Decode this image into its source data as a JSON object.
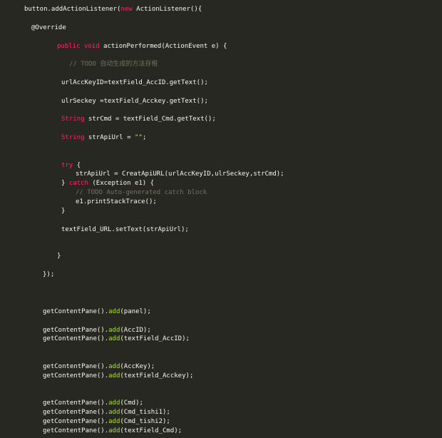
{
  "editor": {
    "background": "#272822",
    "colors": {
      "text": "#f8f8f2",
      "keyword": "#f92672",
      "string": "#e6db74",
      "comment": "#75715e",
      "method": "#a6e22e"
    },
    "lines": [
      {
        "tokens": [
          {
            "t": "button.addActionListener(",
            "c": "plain"
          },
          {
            "t": "new",
            "c": "kw"
          },
          {
            "t": " ActionListener(){",
            "c": "plain"
          }
        ]
      },
      {
        "tokens": [
          {
            "t": "@Override",
            "c": "ann"
          }
        ]
      },
      {
        "tokens": [
          {
            "t": "public",
            "c": "kw"
          },
          {
            "t": " ",
            "c": "plain"
          },
          {
            "t": "void",
            "c": "kw"
          },
          {
            "t": " actionPerformed(ActionEvent e) {",
            "c": "plain"
          }
        ]
      },
      {
        "tokens": [
          {
            "t": "// TODO 自动生成的方法存根",
            "c": "cm"
          }
        ]
      },
      {
        "tokens": [
          {
            "t": "urlAccKeyID=textField_AccID.getText();",
            "c": "plain"
          }
        ]
      },
      {
        "tokens": [
          {
            "t": "ulrSeckey =textField_Acckey.getText();",
            "c": "plain"
          }
        ]
      },
      {
        "tokens": [
          {
            "t": "String",
            "c": "kw"
          },
          {
            "t": " strCmd = textField_Cmd.getText();",
            "c": "plain"
          }
        ]
      },
      {
        "tokens": [
          {
            "t": "String",
            "c": "kw"
          },
          {
            "t": " strApiUrl = ",
            "c": "plain"
          },
          {
            "t": "\"\"",
            "c": "str"
          },
          {
            "t": ";",
            "c": "plain"
          }
        ]
      },
      {
        "tokens": [
          {
            "t": "try",
            "c": "kw"
          },
          {
            "t": " {",
            "c": "plain"
          }
        ]
      },
      {
        "tokens": [
          {
            "t": "strApiUrl = CreatApiURL(urlAccKeyID,ulrSeckey,strCmd);",
            "c": "plain"
          }
        ]
      },
      {
        "tokens": [
          {
            "t": "} ",
            "c": "plain"
          },
          {
            "t": "catch",
            "c": "kw"
          },
          {
            "t": " (Exception e1) {",
            "c": "plain"
          }
        ]
      },
      {
        "tokens": [
          {
            "t": "// TODO Auto-generated catch block",
            "c": "cm"
          }
        ]
      },
      {
        "tokens": [
          {
            "t": "e1.printStackTrace();",
            "c": "plain"
          }
        ]
      },
      {
        "tokens": [
          {
            "t": "}",
            "c": "plain"
          }
        ]
      },
      {
        "tokens": [
          {
            "t": "textField_URL.setText(strApiUrl);",
            "c": "plain"
          }
        ]
      },
      {
        "tokens": [
          {
            "t": "}",
            "c": "plain"
          }
        ]
      },
      {
        "tokens": [
          {
            "t": "});",
            "c": "plain"
          }
        ]
      },
      {
        "tokens": [
          {
            "t": "getContentPane().",
            "c": "plain"
          },
          {
            "t": "add",
            "c": "fn"
          },
          {
            "t": "(panel);",
            "c": "plain"
          }
        ]
      },
      {
        "tokens": [
          {
            "t": "getContentPane().",
            "c": "plain"
          },
          {
            "t": "add",
            "c": "fn"
          },
          {
            "t": "(AccID);",
            "c": "plain"
          }
        ]
      },
      {
        "tokens": [
          {
            "t": "getContentPane().",
            "c": "plain"
          },
          {
            "t": "add",
            "c": "fn"
          },
          {
            "t": "(textField_AccID);",
            "c": "plain"
          }
        ]
      },
      {
        "tokens": [
          {
            "t": "getContentPane().",
            "c": "plain"
          },
          {
            "t": "add",
            "c": "fn"
          },
          {
            "t": "(AccKey);",
            "c": "plain"
          }
        ]
      },
      {
        "tokens": [
          {
            "t": "getContentPane().",
            "c": "plain"
          },
          {
            "t": "add",
            "c": "fn"
          },
          {
            "t": "(textField_Acckey);",
            "c": "plain"
          }
        ]
      },
      {
        "tokens": [
          {
            "t": "getContentPane().",
            "c": "plain"
          },
          {
            "t": "add",
            "c": "fn"
          },
          {
            "t": "(Cmd);",
            "c": "plain"
          }
        ]
      },
      {
        "tokens": [
          {
            "t": "getContentPane().",
            "c": "plain"
          },
          {
            "t": "add",
            "c": "fn"
          },
          {
            "t": "(Cmd_tishi1);",
            "c": "plain"
          }
        ]
      },
      {
        "tokens": [
          {
            "t": "getContentPane().",
            "c": "plain"
          },
          {
            "t": "add",
            "c": "fn"
          },
          {
            "t": "(Cmd_tishi2);",
            "c": "plain"
          }
        ]
      },
      {
        "tokens": [
          {
            "t": "getContentPane().",
            "c": "plain"
          },
          {
            "t": "add",
            "c": "fn"
          },
          {
            "t": "(textField_Cmd);",
            "c": "plain"
          }
        ]
      }
    ]
  }
}
